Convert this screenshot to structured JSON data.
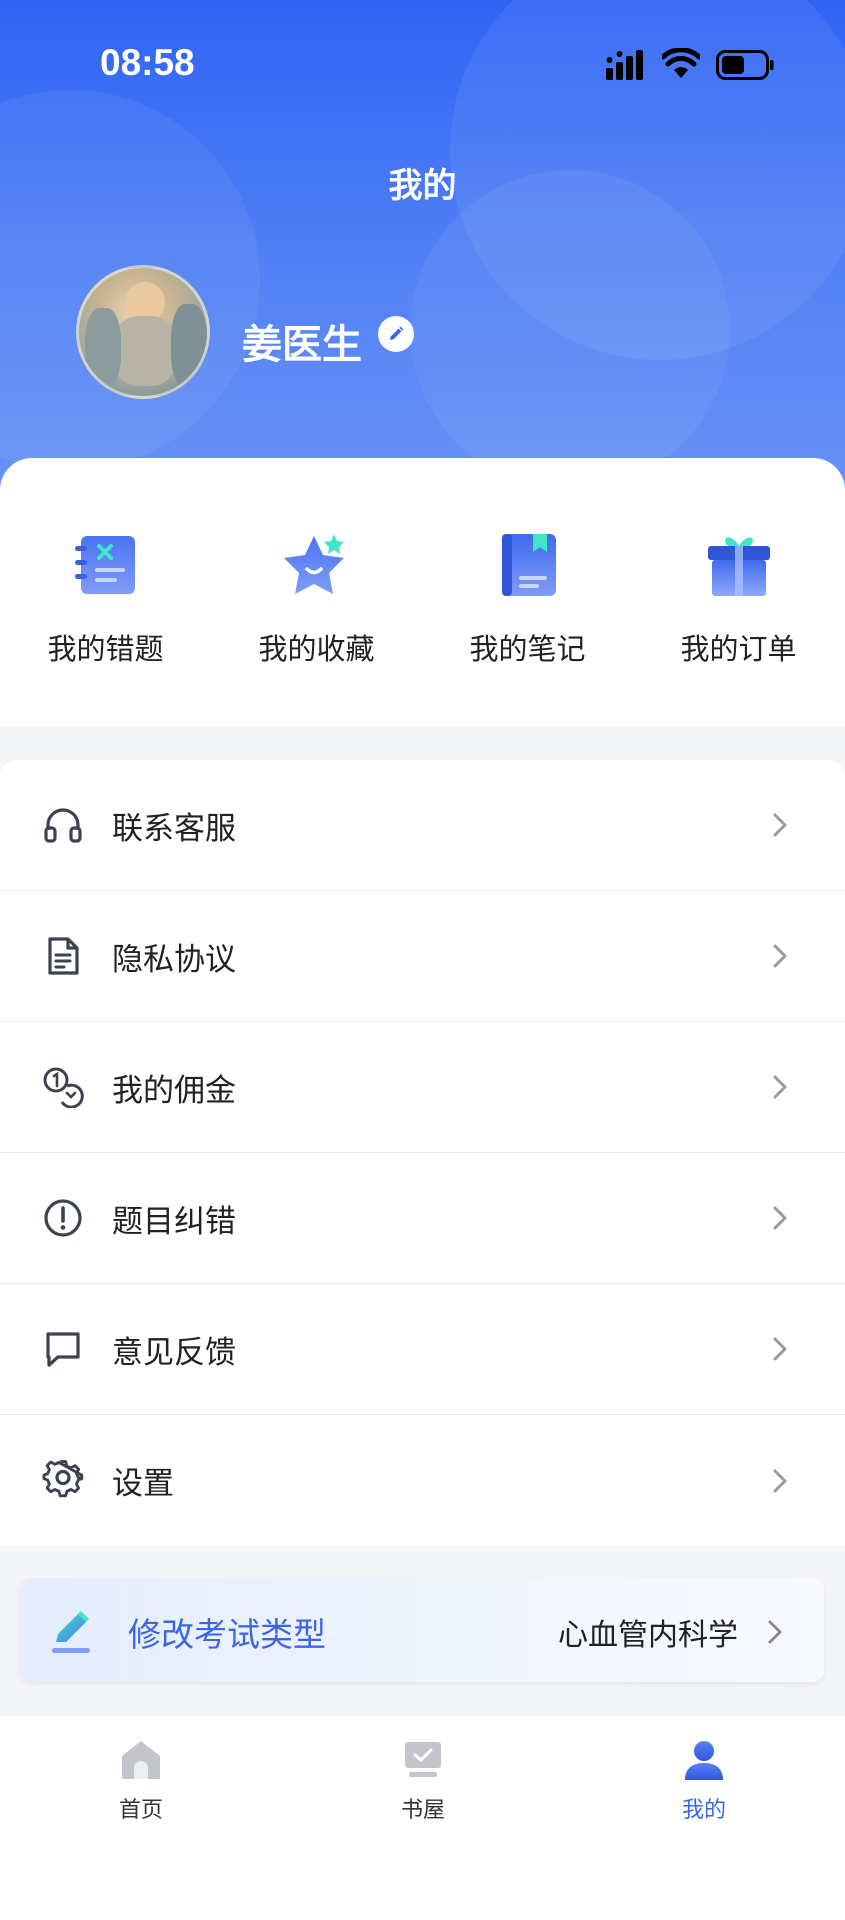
{
  "status_bar": {
    "time": "08:58"
  },
  "header": {
    "title": "我的"
  },
  "profile": {
    "name": "姜医生"
  },
  "quick_actions": [
    {
      "label": "我的错题",
      "icon": "wrong-questions-icon"
    },
    {
      "label": "我的收藏",
      "icon": "favorites-star-icon"
    },
    {
      "label": "我的笔记",
      "icon": "notes-book-icon"
    },
    {
      "label": "我的订单",
      "icon": "orders-gift-icon"
    }
  ],
  "menu": [
    {
      "label": "联系客服",
      "icon": "headset-icon"
    },
    {
      "label": "隐私协议",
      "icon": "document-icon"
    },
    {
      "label": "我的佣金",
      "icon": "coins-icon"
    },
    {
      "label": "题目纠错",
      "icon": "alert-circle-icon"
    },
    {
      "label": "意见反馈",
      "icon": "chat-bubble-icon"
    },
    {
      "label": "设置",
      "icon": "gear-icon"
    }
  ],
  "exam_type": {
    "label": "修改考试类型",
    "value": "心血管内科学"
  },
  "tabbar": [
    {
      "label": "首页",
      "icon": "home-icon",
      "active": false
    },
    {
      "label": "书屋",
      "icon": "bookstore-icon",
      "active": false
    },
    {
      "label": "我的",
      "icon": "profile-icon",
      "active": true
    }
  ],
  "colors": {
    "accent": "#3d66e6",
    "header_top": "#2f63f5",
    "header_bottom": "#6c95f6"
  }
}
